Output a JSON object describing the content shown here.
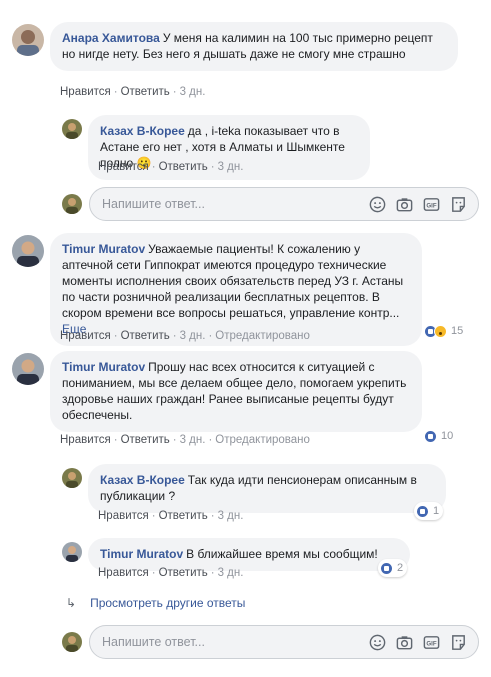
{
  "actions": {
    "like": "Нравится",
    "reply": "Ответить",
    "sep": "·",
    "edited": "Отредактировано"
  },
  "input_placeholder": "Напишите ответ...",
  "icons": [
    "emoji-icon",
    "camera-icon",
    "gif-icon",
    "sticker-icon"
  ],
  "comments": [
    {
      "author": "Анара Хамитова",
      "text": "У меня на калимин на 100 тыс примерно рецепт но нигде нету. Без него я дышать даже не смогу мне страшно",
      "time": "3 дн."
    },
    {
      "author": "Казах В-Корее",
      "text": "да , i-teka показывает что в Астане его нет , хотя в Алматы и Шымкенте полно",
      "emoji": "🙂",
      "time": "3 дн."
    },
    {
      "author": "Timur Muratov",
      "text": "Уважаемые пациенты! К сожалению у аптечной сети Гиппократ имеются процедуро технические моменты исполнения своих обязательств перед УЗ г. Астаны по части розничной реализации бесплатных рецептов. В скором времени все вопросы решаться, управление контр...",
      "more_link": "Еще",
      "time": "3 дн.",
      "reactions": "15"
    },
    {
      "author": "Timur Muratov",
      "text": "Прошу нас всех относится к ситуацией с пониманием, мы все делаем общее дело, помогаем укрепить здоровье наших граждан! Ранее выписаные рецепты будут обеспечены.",
      "time": "3 дн.",
      "reactions": "10"
    },
    {
      "author": "Казах В-Корее",
      "text": "Так куда идти пенсионерам описанным в публикации ?",
      "time": "3 дн.",
      "reactions": "1"
    },
    {
      "author": "Timur Muratov",
      "text": "В ближайшее время мы сообщим!",
      "time": "3 дн.",
      "reactions": "2"
    }
  ],
  "view_more_replies": "Просмотреть другие ответы"
}
